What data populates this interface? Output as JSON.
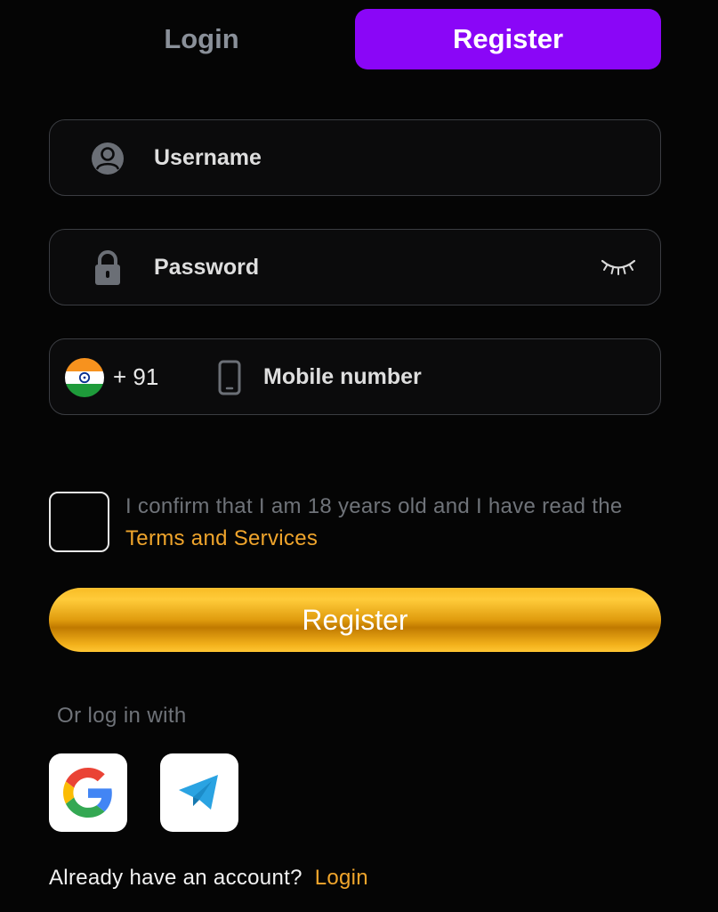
{
  "tabs": {
    "login_label": "Login",
    "register_label": "Register"
  },
  "form": {
    "username_placeholder": "Username",
    "password_placeholder": "Password",
    "country_code": "+ 91",
    "mobile_placeholder": "Mobile number"
  },
  "terms": {
    "text": "I confirm that I am 18 years old and I have read the ",
    "link": "Terms and Services",
    "checked": false
  },
  "register_button": "Register",
  "social": {
    "heading": "Or log in with",
    "providers": [
      "google-icon",
      "telegram-icon"
    ]
  },
  "footer": {
    "prompt": "Already have an account?",
    "link": "Login"
  },
  "colors": {
    "accent_purple": "#8a06f7",
    "accent_gold": "#f0a52c",
    "background": "#050505"
  }
}
